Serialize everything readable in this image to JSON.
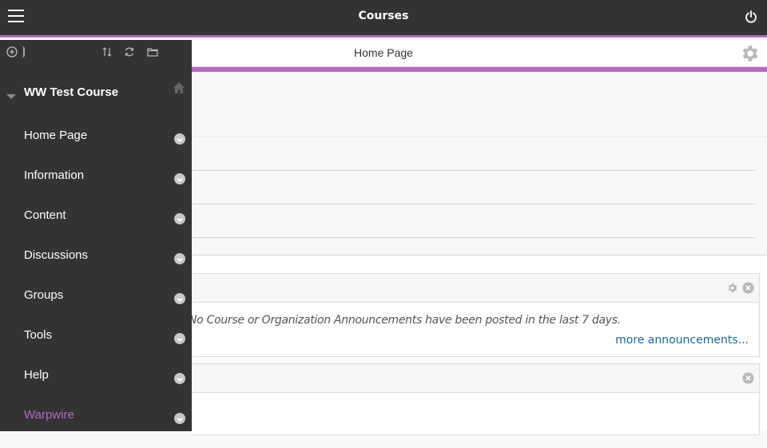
{
  "header": {
    "title": "Courses",
    "menu_icon": "hamburger-icon",
    "power_icon": "power-icon"
  },
  "page": {
    "title": "Home Page",
    "settings_icon": "gear-icon"
  },
  "sidebar": {
    "tools": [
      "add-icon",
      "sort-icon",
      "refresh-icon",
      "folder-icon"
    ],
    "course_title": "WW Test Course",
    "items": [
      {
        "label": "Home Page",
        "active": false
      },
      {
        "label": "Information",
        "active": false
      },
      {
        "label": "Content",
        "active": false
      },
      {
        "label": "Discussions",
        "active": false
      },
      {
        "label": "Groups",
        "active": false
      },
      {
        "label": "Tools",
        "active": false
      },
      {
        "label": "Help",
        "active": false
      },
      {
        "label": "Warpwire",
        "active": true
      }
    ]
  },
  "modules": {
    "announcements": {
      "message": "No Course or Organization Announcements have been posted in the last 7 days.",
      "more_link": "more announcements..."
    }
  },
  "colors": {
    "accent": "#b56ac5",
    "topbar": "#333333",
    "link": "#1b6a94"
  }
}
